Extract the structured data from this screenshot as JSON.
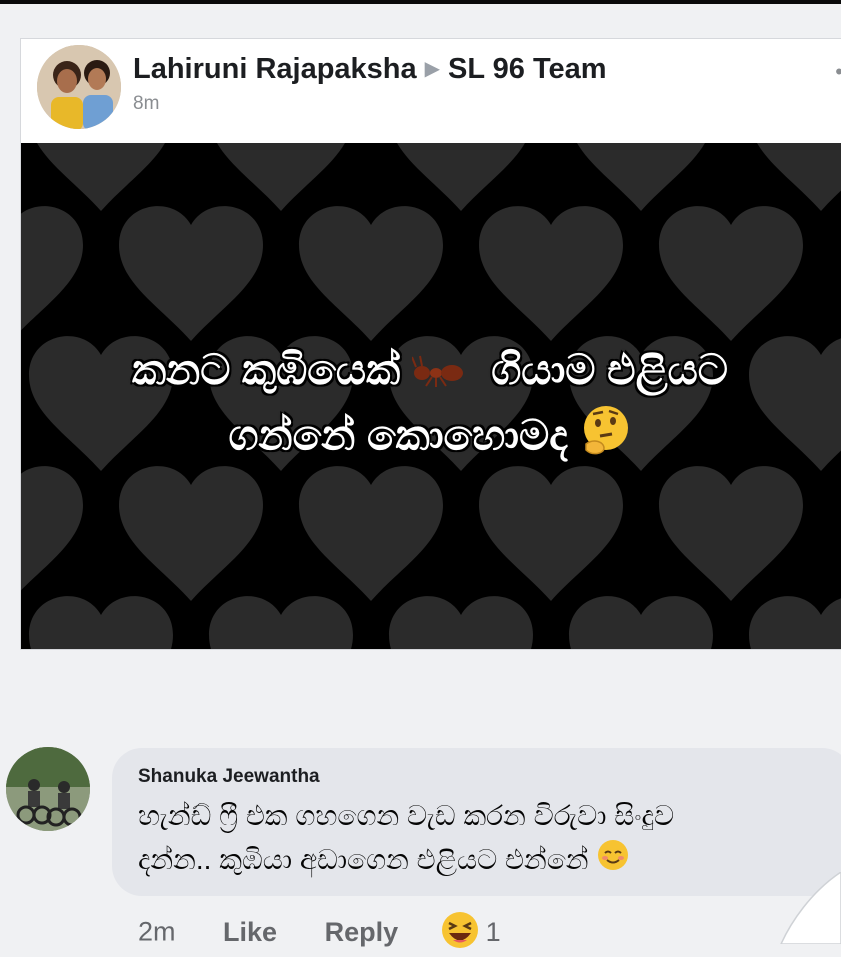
{
  "post": {
    "author": "Lahiruni Rajapaksha",
    "group": "SL 96 Team",
    "time": "8m",
    "image_text_line1_a": "කනට කුඹියෙක්",
    "image_text_line1_b": "ගියාම එළියට",
    "image_text_line2": "ගන්නේ කොහොමද"
  },
  "comment": {
    "author": "Shanuka Jeewantha",
    "text_line1": "හැන්ඩ් ෆ්‍රී එක ගහගෙන වැඩ කරන විරුවා සිංදුව",
    "text_line2": "දන්න.. කුඹියා අඩාගෙන එළියට එන්නේ",
    "time": "2m",
    "like_label": "Like",
    "reply_label": "Reply",
    "reaction_count": "1"
  },
  "icons": {
    "ant": "ant-emoji-icon",
    "thinking": "thinking-face-icon",
    "relieved": "relieved-face-icon",
    "laughing": "laughing-reaction-icon",
    "more": "more-options-icon"
  },
  "colors": {
    "image_bg": "#000000",
    "hearts": "#2b2b2b",
    "bubble": "#e4e6eb",
    "meta_text": "#65676b"
  }
}
